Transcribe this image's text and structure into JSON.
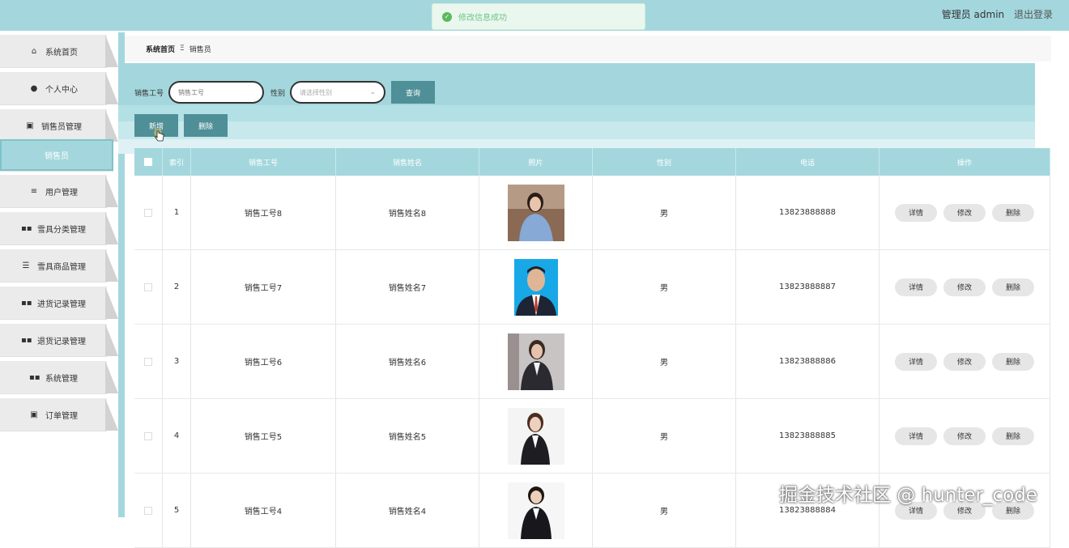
{
  "toast": {
    "message": "修改信息成功"
  },
  "header": {
    "user_label": "管理员 admin",
    "logout_label": "退出登录"
  },
  "sidebar": {
    "items": [
      {
        "label": "系统首页",
        "icon": "home-icon"
      },
      {
        "label": "个人中心",
        "icon": "user-icon"
      },
      {
        "label": "销售员管理",
        "icon": "clipboard-icon"
      },
      {
        "label": "销售员",
        "icon": ""
      },
      {
        "label": "用户管理",
        "icon": "list-icon"
      },
      {
        "label": "雪具分类管理",
        "icon": "grid-icon"
      },
      {
        "label": "雪具商品管理",
        "icon": "sliders-icon"
      },
      {
        "label": "进货记录管理",
        "icon": "grid-icon"
      },
      {
        "label": "退货记录管理",
        "icon": "grid-icon"
      },
      {
        "label": "系统管理",
        "icon": "grid-icon"
      },
      {
        "label": "订单管理",
        "icon": "clipboard-icon"
      }
    ]
  },
  "breadcrumb": {
    "home": "系统首页",
    "separator": "Ξ",
    "current": "销售员"
  },
  "search": {
    "id_label": "销售工号",
    "id_placeholder": "销售工号",
    "gender_label": "性别",
    "gender_placeholder": "请选择性别",
    "query_label": "查询"
  },
  "actions": {
    "add_label": "新增",
    "delete_label": "删除"
  },
  "table": {
    "headers": [
      "索引",
      "销售工号",
      "销售姓名",
      "照片",
      "性别",
      "电话",
      "操作"
    ],
    "rows": [
      {
        "index": "1",
        "id": "销售工号8",
        "name": "销售姓名8",
        "gender": "男",
        "phone": "13823888888"
      },
      {
        "index": "2",
        "id": "销售工号7",
        "name": "销售姓名7",
        "gender": "男",
        "phone": "13823888887"
      },
      {
        "index": "3",
        "id": "销售工号6",
        "name": "销售姓名6",
        "gender": "男",
        "phone": "13823888886"
      },
      {
        "index": "4",
        "id": "销售工号5",
        "name": "销售姓名5",
        "gender": "男",
        "phone": "13823888885"
      },
      {
        "index": "5",
        "id": "销售工号4",
        "name": "销售姓名4",
        "gender": "男",
        "phone": "13823888884"
      }
    ],
    "op_labels": {
      "detail": "详情",
      "edit": "修改",
      "delete": "删除"
    }
  },
  "watermark": "掘金技术社区 @ hunter_code",
  "colors": {
    "accent": "#a3d7dd",
    "button": "#4f8f97",
    "toast_text": "#6cc58a"
  }
}
